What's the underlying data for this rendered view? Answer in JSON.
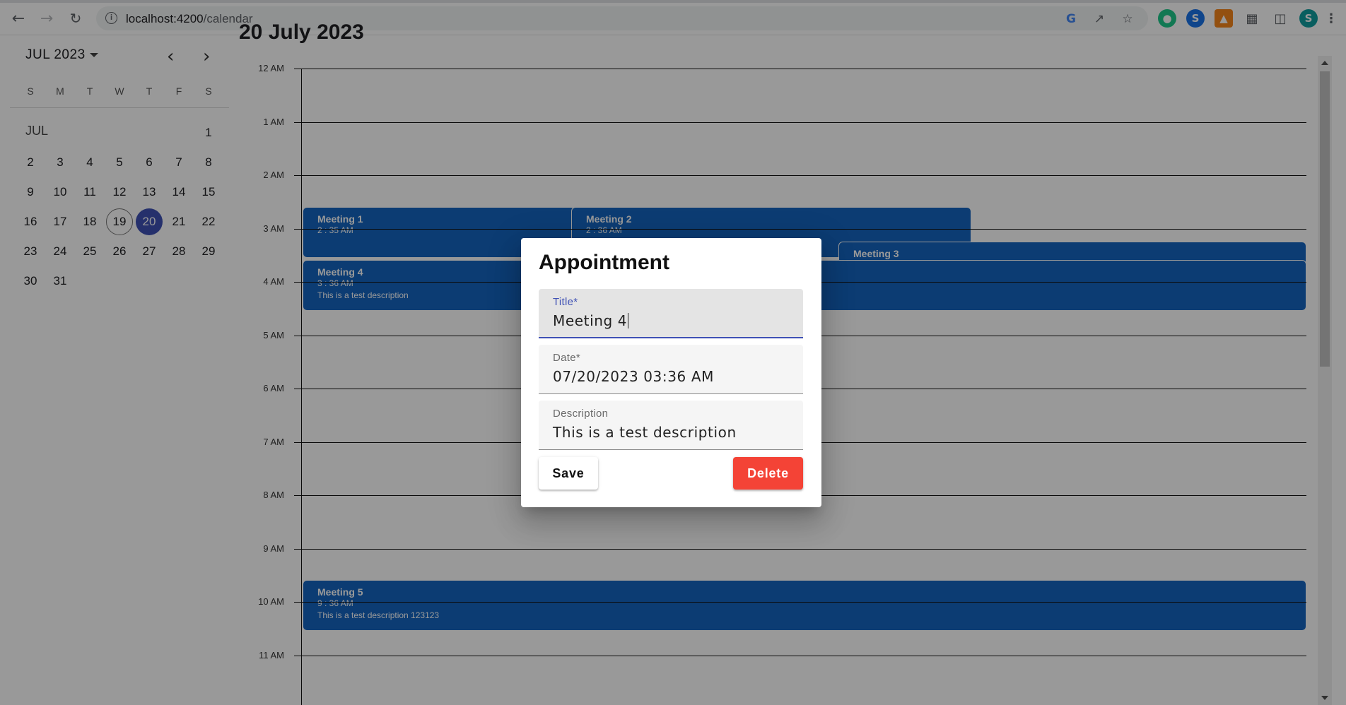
{
  "browser": {
    "url_host": "localhost:4200",
    "url_path": "/calendar",
    "icons": [
      "back-icon",
      "forward-icon",
      "reload-icon",
      "site-info-icon",
      "google-icon",
      "share-icon",
      "star-icon",
      "extension-icon",
      "puzzle-icon",
      "side-panel-icon",
      "profile-avatar",
      "menu-icon"
    ],
    "profile_initial": "S"
  },
  "sidebar": {
    "month_label": "JUL 2023",
    "weekdays": [
      "S",
      "M",
      "T",
      "W",
      "T",
      "F",
      "S"
    ],
    "short_month": "JUL",
    "today": "19",
    "selected": "20",
    "weeks": [
      [
        "",
        "",
        "",
        "",
        "",
        "",
        "1"
      ],
      [
        "2",
        "3",
        "4",
        "5",
        "6",
        "7",
        "8"
      ],
      [
        "9",
        "10",
        "11",
        "12",
        "13",
        "14",
        "15"
      ],
      [
        "16",
        "17",
        "18",
        "19",
        "20",
        "21",
        "22"
      ],
      [
        "23",
        "24",
        "25",
        "26",
        "27",
        "28",
        "29"
      ],
      [
        "30",
        "31",
        "",
        "",
        "",
        "",
        ""
      ]
    ]
  },
  "dayview": {
    "title": "20 July 2023",
    "hours": [
      "12 AM",
      "1 AM",
      "2 AM",
      "3 AM",
      "4 AM",
      "5 AM",
      "6 AM",
      "7 AM",
      "8 AM",
      "9 AM",
      "10 AM",
      "11 AM"
    ],
    "events": [
      {
        "title": "Meeting 1",
        "time": "2 : 35 AM",
        "desc": ""
      },
      {
        "title": "Meeting 2",
        "time": "2 : 36 AM",
        "desc": ""
      },
      {
        "title": "Meeting 3",
        "time": "",
        "desc": ""
      },
      {
        "title": "Meeting 4",
        "time": "3 : 36 AM",
        "desc": "This is a test description"
      },
      {
        "title": "Meeting 5",
        "time": "9 : 36 AM",
        "desc": "This is a test description 123123"
      }
    ]
  },
  "dialog": {
    "title": "Appointment",
    "fields": {
      "title_label": "Title*",
      "title_value": "Meeting 4",
      "date_label": "Date*",
      "date_value": "07/20/2023 03:36 AM",
      "description_label": "Description",
      "description_value": "This is a test description"
    },
    "save_label": "Save",
    "delete_label": "Delete"
  },
  "colors": {
    "event": "#1565c0",
    "accent": "#3f51b5",
    "delete": "#f44336"
  }
}
